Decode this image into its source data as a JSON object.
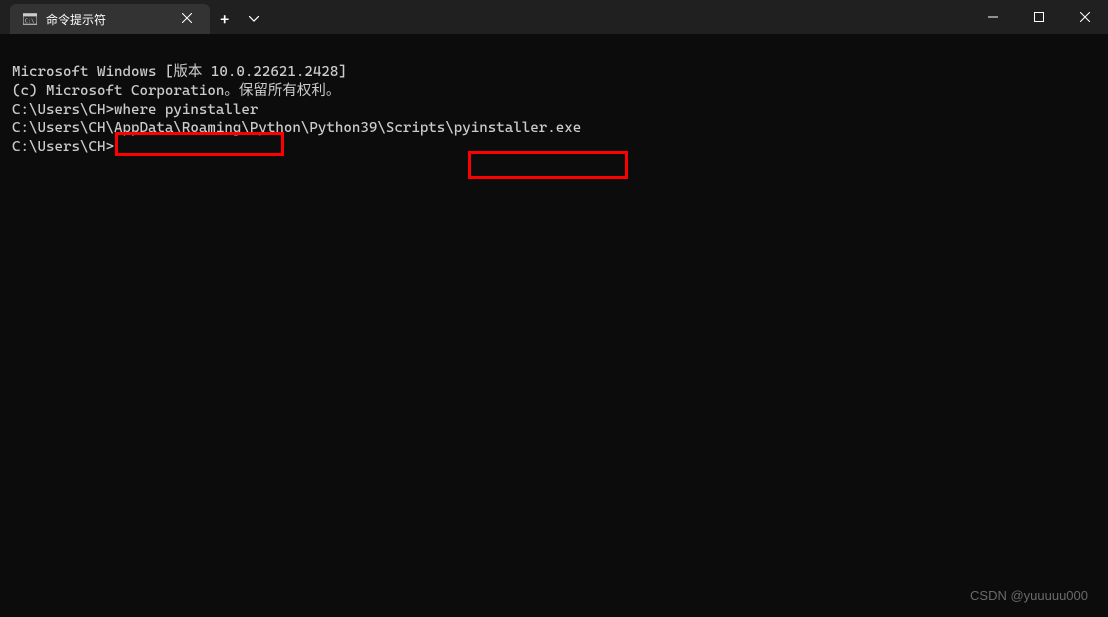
{
  "titlebar": {
    "tab": {
      "title": "命令提示符",
      "icon_name": "cmd-icon"
    },
    "new_tab_label": "+",
    "dropdown_label": "⌄"
  },
  "terminal": {
    "line1": "Microsoft Windows [版本 10.0.22621.2428]",
    "line2": "(c) Microsoft Corporation。保留所有权利。",
    "line3": "",
    "line4_prompt": "C:\\Users\\CH>",
    "line4_cmd": "where pyinstaller",
    "line5_prefix": "C:\\Users\\CH\\AppData\\Roaming\\Python\\Python39\\Scripts",
    "line5_suffix": "\\pyinstaller.exe",
    "line6": "",
    "line7": "C:\\Users\\CH>"
  },
  "watermark": "CSDN @yuuuuu000"
}
